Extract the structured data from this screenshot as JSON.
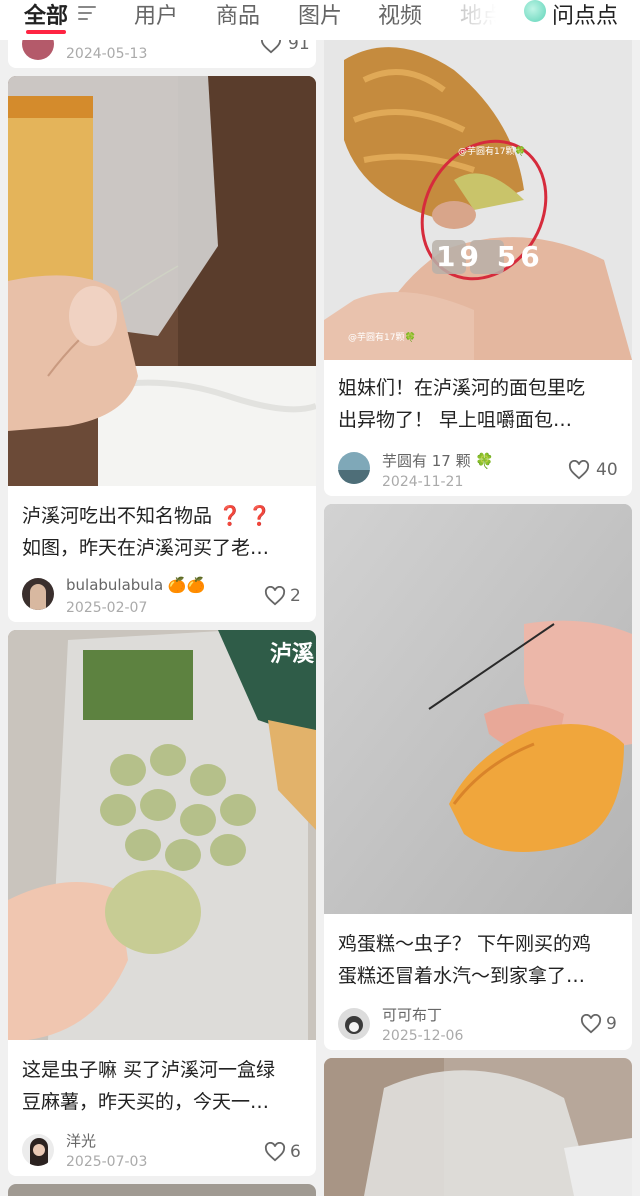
{
  "tabs": [
    "全部",
    "用户",
    "商品",
    "图片",
    "视频",
    "地点"
  ],
  "ask_label": "问点点",
  "partial_card": {
    "date": "2024-05-13",
    "likes": "91"
  },
  "cards": [
    {
      "title_line1": "泸溪河吃出不知名物品 ❓ ❓",
      "title_line2": "如图，昨天在泸溪河买了老…",
      "author": "bulabulabula 🍊🍊",
      "date": "2025-02-07",
      "likes": "2"
    },
    {
      "title_line1": "姐妹们！在泸溪河的面包里吃",
      "title_line2": "出异物了！ 早上咀嚼面包…",
      "author": "芋圆有 17 颗 🍀",
      "date": "2024-11-21",
      "likes": "40",
      "overlay_timestamp": "19 56",
      "watermark": "@芋圆有17颗🍀"
    },
    {
      "title_line1": "鸡蛋糕～虫子？ 下午刚买的鸡",
      "title_line2": "蛋糕还冒着水汽～到家拿了…",
      "author": "可可布丁",
      "date": "2025-12-06",
      "likes": "9"
    },
    {
      "title_line1": "这是虫子嘛 买了泸溪河一盒绿",
      "title_line2": "豆麻薯，昨天买的，今天一…",
      "author": "洋光",
      "date": "2025-07-03",
      "likes": "6",
      "package_text": "泸溪"
    }
  ],
  "colors": {
    "accent": "#ff2442",
    "background": "#f0f0f0",
    "card": "#ffffff"
  }
}
